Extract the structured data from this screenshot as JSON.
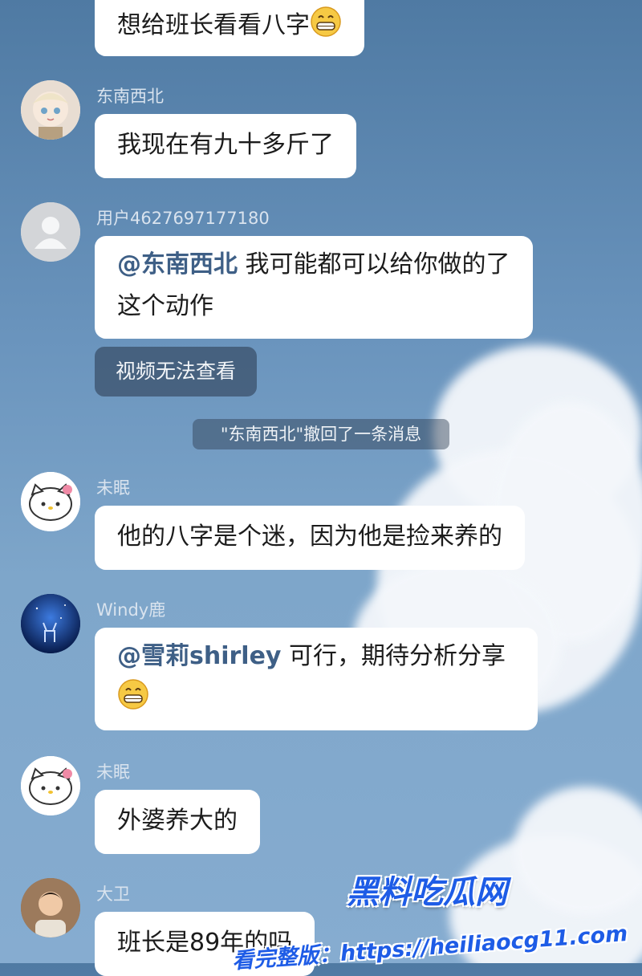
{
  "colors": {
    "mention": "#3e5f86",
    "bubble": "#ffffff",
    "watermark": "#1e5ce6"
  },
  "messages": [
    {
      "sender": "",
      "text": "想给班长看看八字",
      "emoji": "grin-emoji"
    },
    {
      "sender": "东南西北",
      "text": "我现在有九十多斤了"
    },
    {
      "sender": "用户4627697177180",
      "mention": "@东南西北",
      "text": " 我可能都可以给你做的了这个动作"
    },
    {
      "sender": "未眠",
      "text": "他的八字是个迷，因为他是捡来养的"
    },
    {
      "sender": "Windy鹿",
      "mention": "@雪莉shirley",
      "text": " 可行，期待分析分享",
      "emoji": "grin-emoji"
    },
    {
      "sender": "未眠",
      "text": "外婆养大的"
    },
    {
      "sender": "大卫",
      "text": "班长是89年的吗"
    }
  ],
  "video_unavailable": "视频无法查看",
  "system_notice": "\"东南西北\"撤回了一条消息",
  "watermark": {
    "logo": "黑料吃瓜网",
    "url": "看完整版：https://heiliaocg11.com"
  }
}
